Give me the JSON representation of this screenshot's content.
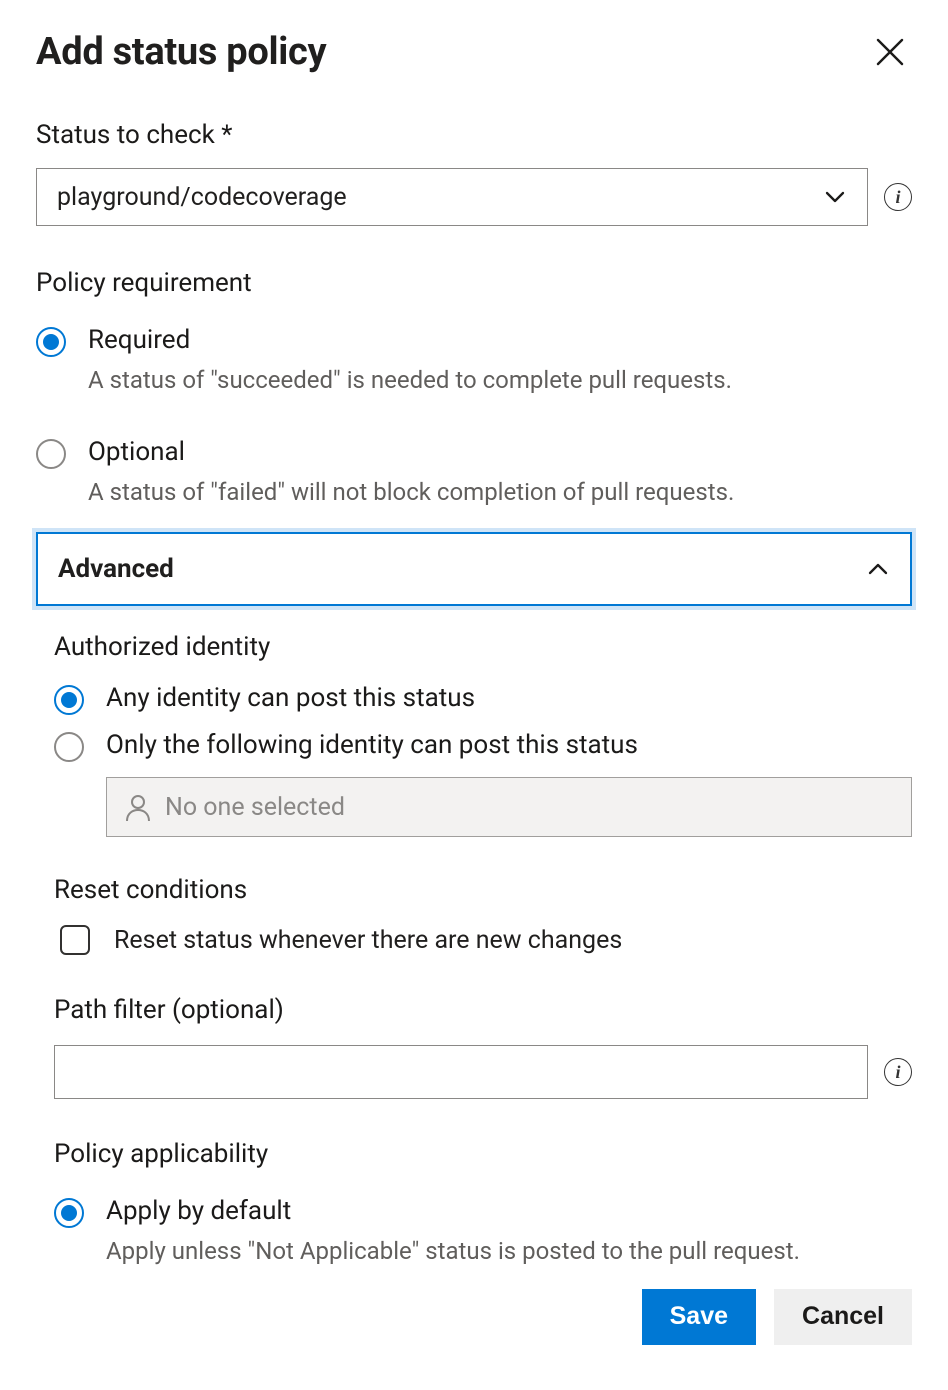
{
  "header": {
    "title": "Add status policy"
  },
  "status_to_check": {
    "label": "Status to check *",
    "value": "playground/codecoverage"
  },
  "policy_requirement": {
    "label": "Policy requirement",
    "options": [
      {
        "title": "Required",
        "desc": "A status of \"succeeded\" is needed to complete pull requests.",
        "checked": true
      },
      {
        "title": "Optional",
        "desc": "A status of \"failed\" will not block completion of pull requests.",
        "checked": false
      }
    ]
  },
  "advanced": {
    "title": "Advanced",
    "expanded": true,
    "authorized_identity": {
      "label": "Authorized identity",
      "options": [
        {
          "title": "Any identity can post this status",
          "checked": true
        },
        {
          "title": "Only the following identity can post this status",
          "checked": false
        }
      ],
      "picker_placeholder": "No one selected"
    },
    "reset_conditions": {
      "label": "Reset conditions",
      "checkbox_label": "Reset status whenever there are new changes",
      "checked": false
    },
    "path_filter": {
      "label": "Path filter (optional)",
      "value": ""
    },
    "policy_applicability": {
      "label": "Policy applicability",
      "options": [
        {
          "title": "Apply by default",
          "desc": "Apply unless \"Not Applicable\" status is posted to the pull request.",
          "checked": true
        }
      ]
    }
  },
  "footer": {
    "save": "Save",
    "cancel": "Cancel"
  }
}
